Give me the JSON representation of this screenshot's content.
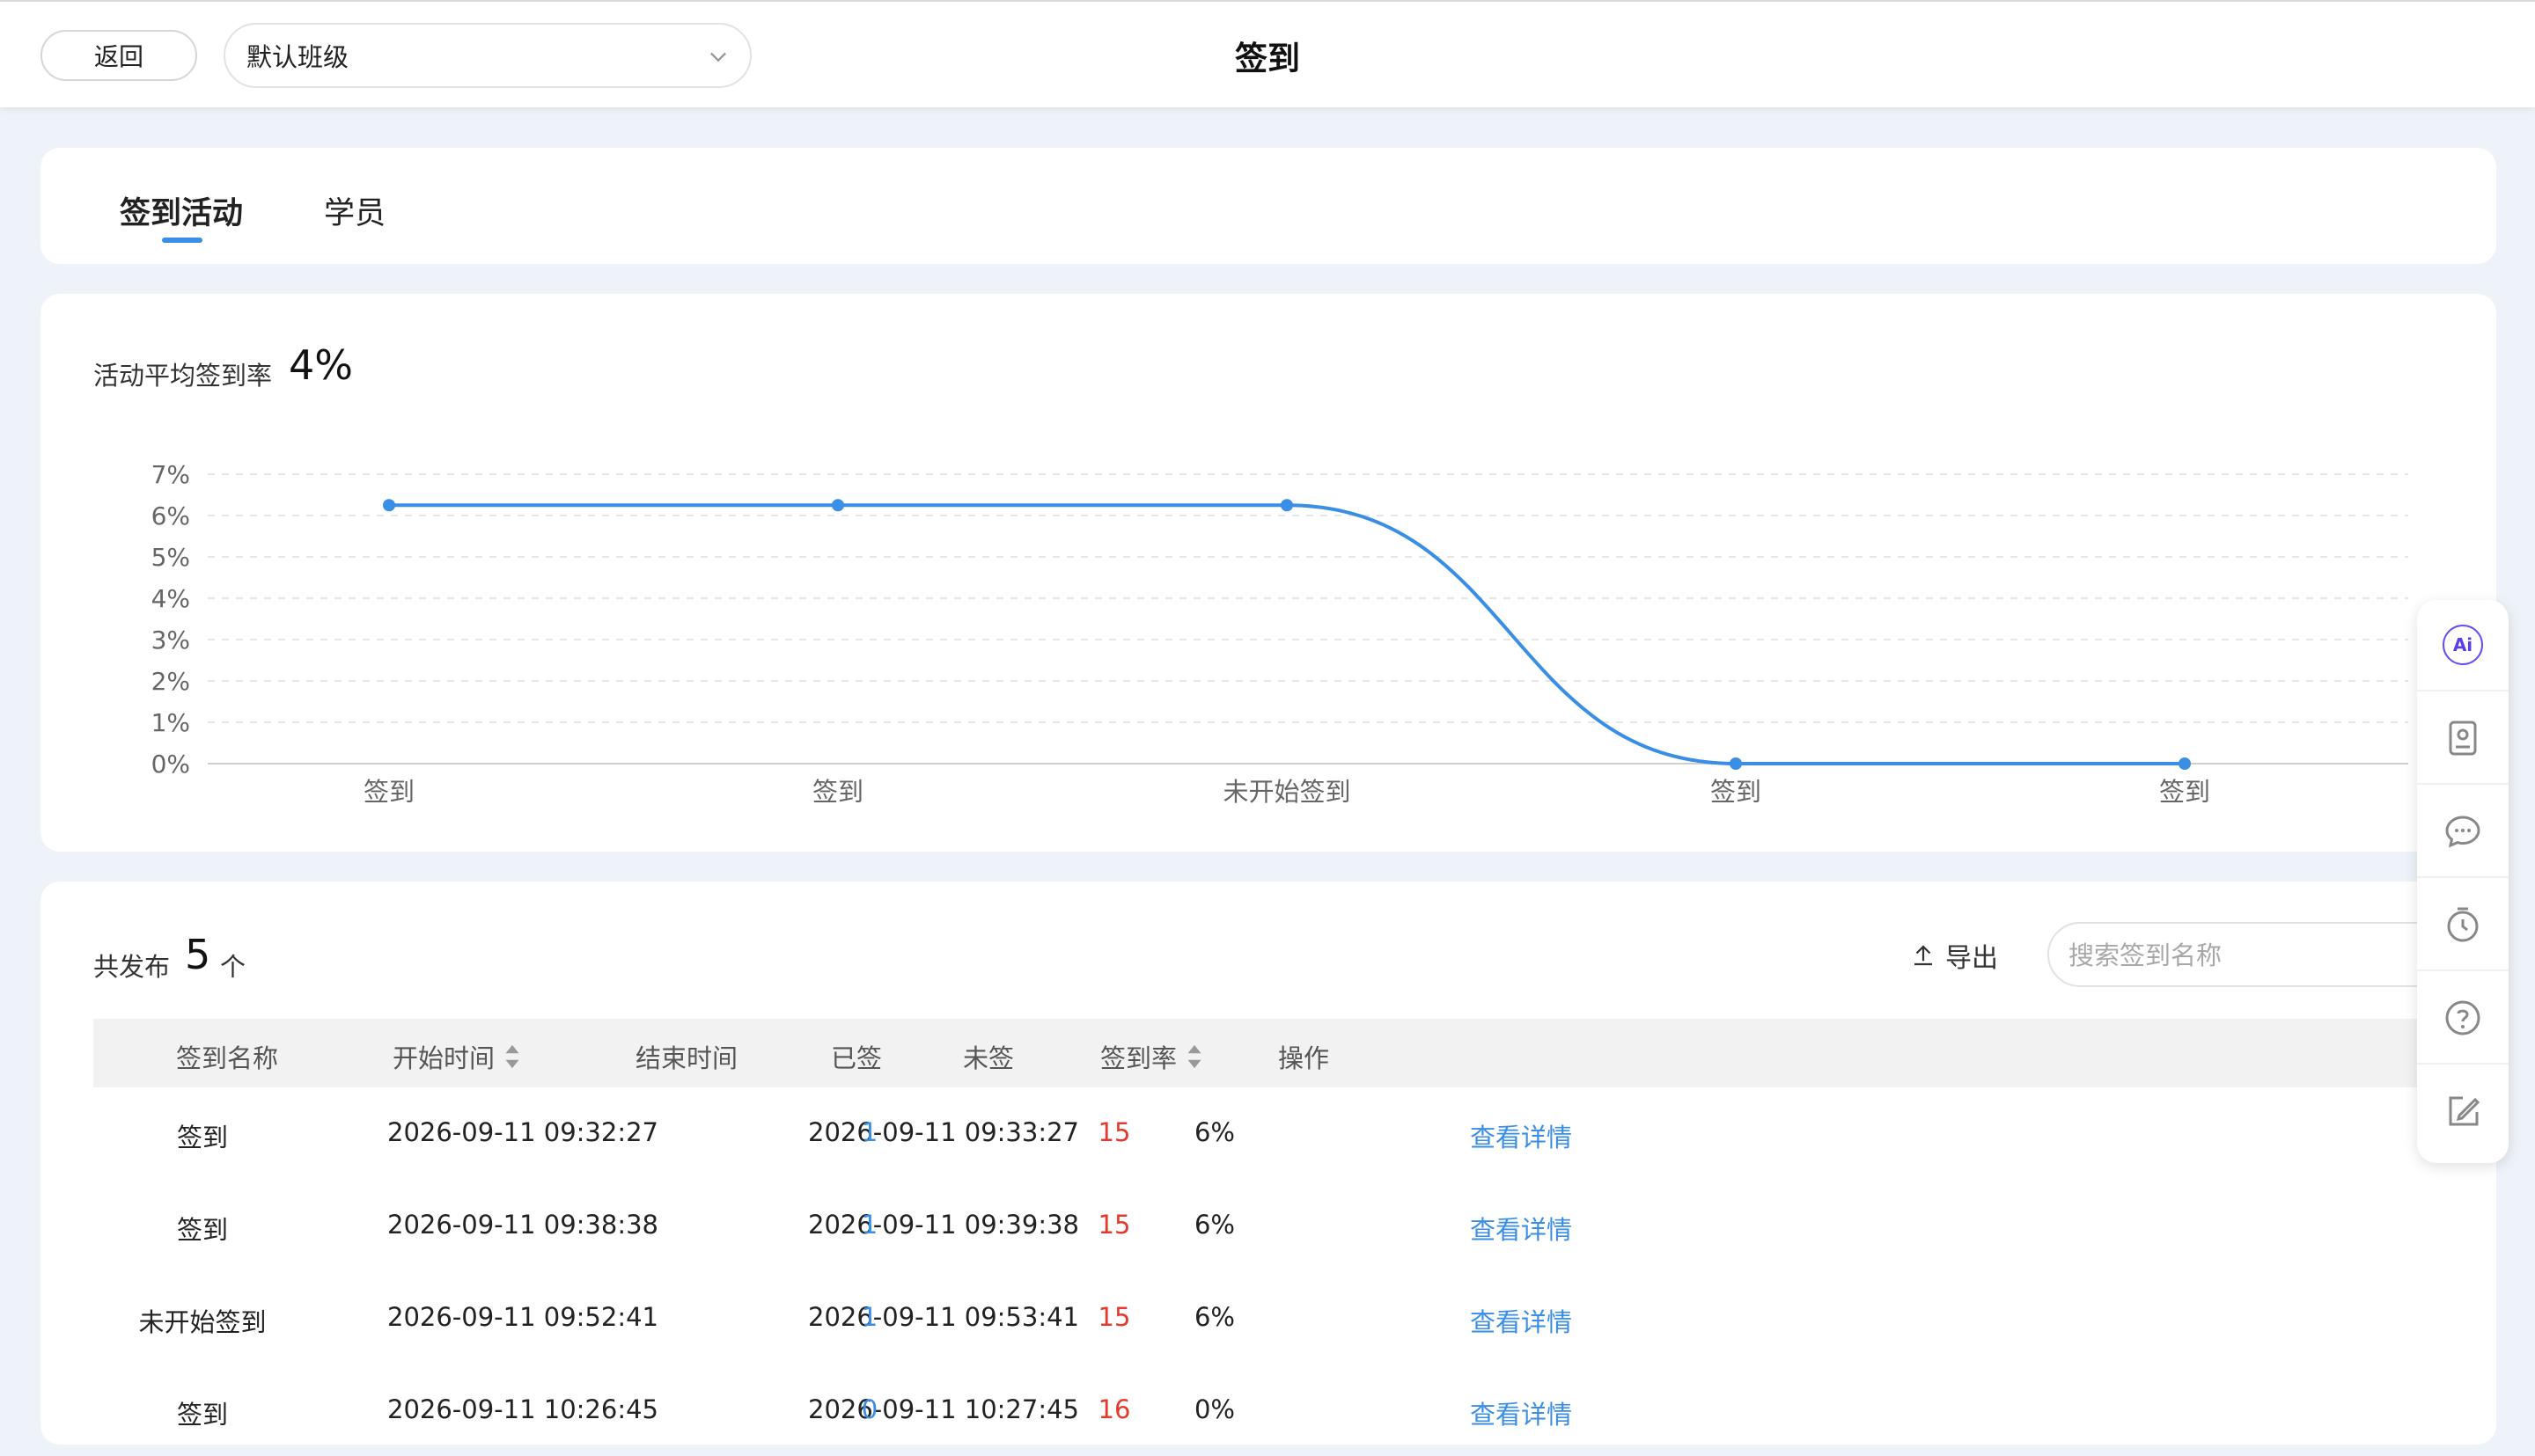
{
  "header": {
    "back_label": "返回",
    "class_select_value": "默认班级",
    "title": "签到"
  },
  "tabs": [
    {
      "label": "签到活动",
      "active": true
    },
    {
      "label": "学员",
      "active": false
    }
  ],
  "stats": {
    "avg_label": "活动平均签到率",
    "avg_value": "4%"
  },
  "chart_data": {
    "type": "line",
    "categories": [
      "签到",
      "签到",
      "未开始签到",
      "签到",
      "签到"
    ],
    "values": [
      6.25,
      6.25,
      6.25,
      0,
      0
    ],
    "y_ticks": [
      "0%",
      "1%",
      "2%",
      "3%",
      "4%",
      "5%",
      "6%",
      "7%"
    ],
    "ylim": [
      0,
      7
    ],
    "grid": true,
    "color": "#3a8ee6"
  },
  "table_header": {
    "count_label": "共发布",
    "count_value": "5",
    "count_unit": "个",
    "export_label": "导出",
    "search_placeholder": "搜索签到名称"
  },
  "columns": [
    "签到名称",
    "开始时间",
    "结束时间",
    "已签",
    "未签",
    "签到率",
    "操作"
  ],
  "rows": [
    {
      "name": "签到",
      "start": "2026-09-11 09:32:27",
      "end": "2026-09-11 09:33:27",
      "signed": "1",
      "unsigned": "15",
      "rate": "6%",
      "action": "查看详情"
    },
    {
      "name": "签到",
      "start": "2026-09-11 09:38:38",
      "end": "2026-09-11 09:39:38",
      "signed": "1",
      "unsigned": "15",
      "rate": "6%",
      "action": "查看详情"
    },
    {
      "name": "未开始签到",
      "start": "2026-09-11 09:52:41",
      "end": "2026-09-11 09:53:41",
      "signed": "1",
      "unsigned": "15",
      "rate": "6%",
      "action": "查看详情"
    },
    {
      "name": "签到",
      "start": "2026-09-11 10:26:45",
      "end": "2026-09-11 10:27:45",
      "signed": "0",
      "unsigned": "16",
      "rate": "0%",
      "action": "查看详情"
    }
  ],
  "side_toolbar": [
    "ai-icon",
    "contact-card-icon",
    "chat-icon",
    "timer-icon",
    "help-icon",
    "edit-icon"
  ],
  "colors": {
    "accent": "#3a8ee6",
    "danger": "#e23a2e",
    "background": "#eef3f9"
  }
}
